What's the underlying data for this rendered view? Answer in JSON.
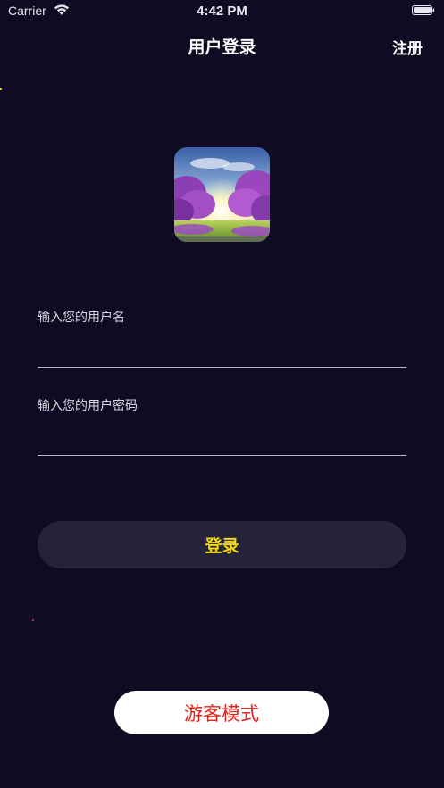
{
  "status_bar": {
    "carrier": "Carrier",
    "time": "4:42 PM"
  },
  "nav": {
    "title": "用户登录",
    "register_label": "注册"
  },
  "form": {
    "username_label": "输入您的用户名",
    "username_value": "",
    "password_label": "输入您的用户密码",
    "password_value": "",
    "login_label": "登录"
  },
  "guest": {
    "label": "游客模式"
  },
  "colors": {
    "background": "#100b22",
    "login_button_bg": "#24233a",
    "login_text": "#f5d90a",
    "guest_text": "#e0261a"
  },
  "icons": {
    "wifi": "wifi-icon",
    "battery": "battery-icon",
    "logo": "app-logo-lavender-landscape"
  }
}
